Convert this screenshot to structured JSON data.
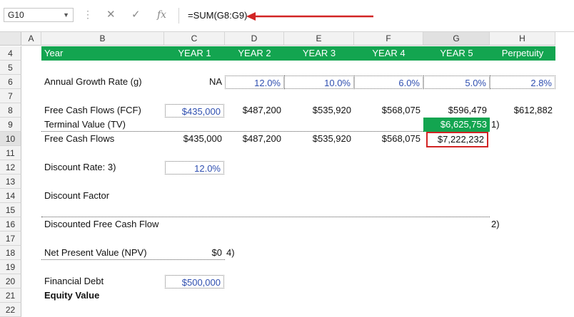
{
  "formula_bar": {
    "name_box": "G10",
    "cancel_glyph": "✕",
    "enter_glyph": "✓",
    "fx_label": "fx",
    "formula": "=SUM(G8:G9)"
  },
  "columns": [
    "A",
    "B",
    "C",
    "D",
    "E",
    "F",
    "G",
    "H"
  ],
  "rows": [
    "4",
    "5",
    "6",
    "7",
    "8",
    "9",
    "10",
    "11",
    "12",
    "13",
    "14",
    "15",
    "16",
    "17",
    "18",
    "19",
    "20",
    "21",
    "22"
  ],
  "sheet": {
    "header": {
      "label": "Year",
      "years": [
        "YEAR 1",
        "YEAR 2",
        "YEAR 3",
        "YEAR 4",
        "YEAR 5",
        "Perpetuity"
      ]
    },
    "growth": {
      "label": "Annual Growth Rate (g)",
      "values": [
        "NA",
        "12.0%",
        "10.0%",
        "6.0%",
        "5.0%",
        "2.8%"
      ]
    },
    "fcf": {
      "label": "Free Cash Flows (FCF)",
      "values": [
        "$435,000",
        "$487,200",
        "$535,920",
        "$568,075",
        "$596,479",
        "$612,882"
      ]
    },
    "tv": {
      "label": "Terminal Value (TV)",
      "value": "$6,625,753",
      "note": "1)"
    },
    "fcf_total": {
      "label": "Free Cash Flows",
      "values": [
        "$435,000",
        "$487,200",
        "$535,920",
        "$568,075",
        "$7,222,232"
      ]
    },
    "discount_rate": {
      "label": "Discount Rate: 3)",
      "value": "12.0%"
    },
    "discount_factor": {
      "label": "Discount Factor"
    },
    "dfcf": {
      "label": "Discounted Free Cash Flow",
      "note": "2)"
    },
    "npv": {
      "label": "Net Present Value (NPV)",
      "value": "$0",
      "note": "4)"
    },
    "debt": {
      "label": "Financial Debt",
      "value": "$500,000"
    },
    "equity": {
      "label": "Equity Value"
    }
  },
  "colors": {
    "header_green": "#13a550",
    "input_blue": "#2f4fb0",
    "selection_red": "#d22424"
  }
}
